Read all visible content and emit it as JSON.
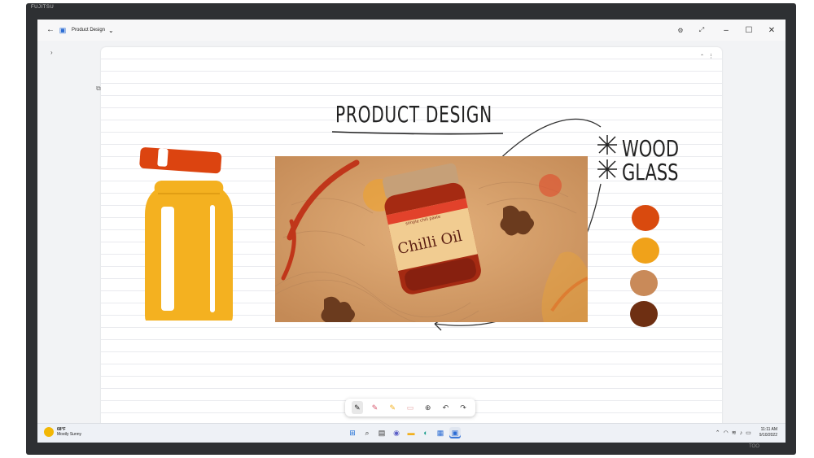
{
  "device": {
    "brand": "FUJITSU",
    "model": "TOO"
  },
  "window": {
    "title": "Product Design"
  },
  "canvas": {
    "heading": "PRODUCT DESIGN",
    "materials": [
      "WOOD",
      "GLASS"
    ],
    "swatches": [
      "#d94a0e",
      "#f0a21a",
      "#c98a59",
      "#6e2f12"
    ],
    "jar_label": "Chilli Oil",
    "jar_sublabel": "simple chili paste"
  },
  "ink_toolbar": {
    "tools": [
      {
        "name": "pen-black",
        "color": "#222222",
        "active": true
      },
      {
        "name": "pen-pink",
        "color": "#d6566b"
      },
      {
        "name": "highlighter-yellow",
        "color": "#f2b01e"
      },
      {
        "name": "eraser",
        "color": "#e6a5a5"
      }
    ]
  },
  "taskbar": {
    "weather_temp": "68°F",
    "weather_desc": "Mostly Sunny",
    "clock_time": "11:11 AM",
    "clock_date": "9/10/2022"
  }
}
